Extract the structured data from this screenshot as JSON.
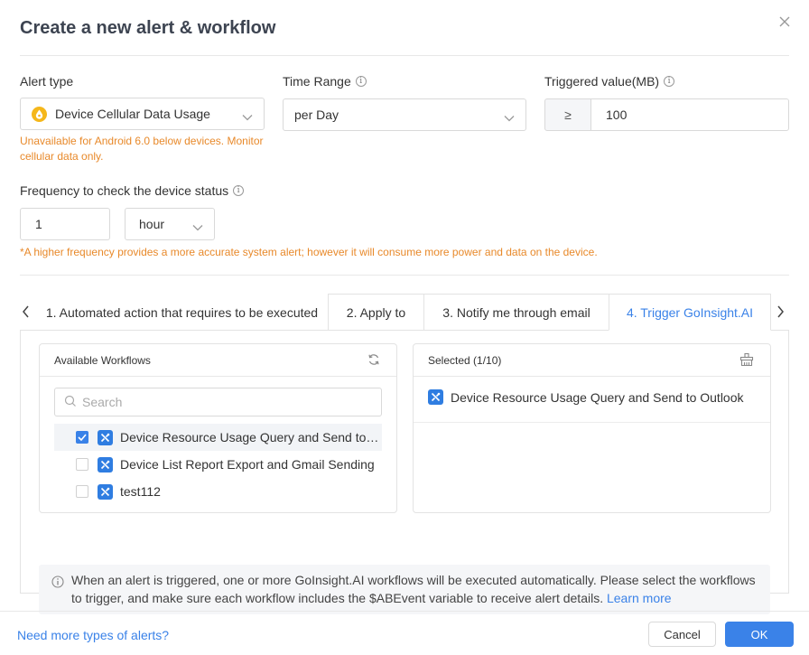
{
  "dialog": {
    "title": "Create a new alert & workflow"
  },
  "alert_type": {
    "label": "Alert type",
    "value": "Device Cellular Data Usage",
    "icon": "water-drop-icon",
    "hint": "Unavailable for Android 6.0 below devices. Monitor cellular data only."
  },
  "time_range": {
    "label": "Time Range",
    "value": "per Day"
  },
  "triggered_value": {
    "label": "Triggered value(MB)",
    "operator": "≥",
    "value": "100"
  },
  "frequency": {
    "label": "Frequency to check the device status",
    "value": "1",
    "unit": "hour",
    "hint": "*A higher frequency provides a more accurate system alert; however it will consume more power and data on the device."
  },
  "tabs": [
    {
      "label": "1. Automated action that requires to be executed"
    },
    {
      "label": "2. Apply to"
    },
    {
      "label": "3. Notify me through email"
    },
    {
      "label": "4. Trigger GoInsight.AI"
    }
  ],
  "active_tab": 3,
  "available": {
    "title": "Available Workflows",
    "search_placeholder": "Search",
    "items": [
      {
        "label": "Device Resource Usage Query and Send to Out...",
        "checked": true
      },
      {
        "label": "Device List Report Export and Gmail Sending",
        "checked": false
      },
      {
        "label": "test112",
        "checked": false
      }
    ]
  },
  "selected": {
    "title": "Selected (1/10)",
    "items": [
      {
        "label": "Device Resource Usage Query and Send to Outlook"
      }
    ]
  },
  "notice": {
    "text": "When an alert is triggered, one or more GoInsight.AI workflows will be executed automatically. Please select the workflows to trigger, and make sure each workflow includes the $ABEvent variable to receive alert details.",
    "link": "Learn more"
  },
  "footer": {
    "more_link": "Need more types of alerts?",
    "cancel": "Cancel",
    "ok": "OK"
  },
  "colors": {
    "accent": "#3a82e8",
    "warning": "#e8892a",
    "workflow_icon": "#2f7de1"
  }
}
